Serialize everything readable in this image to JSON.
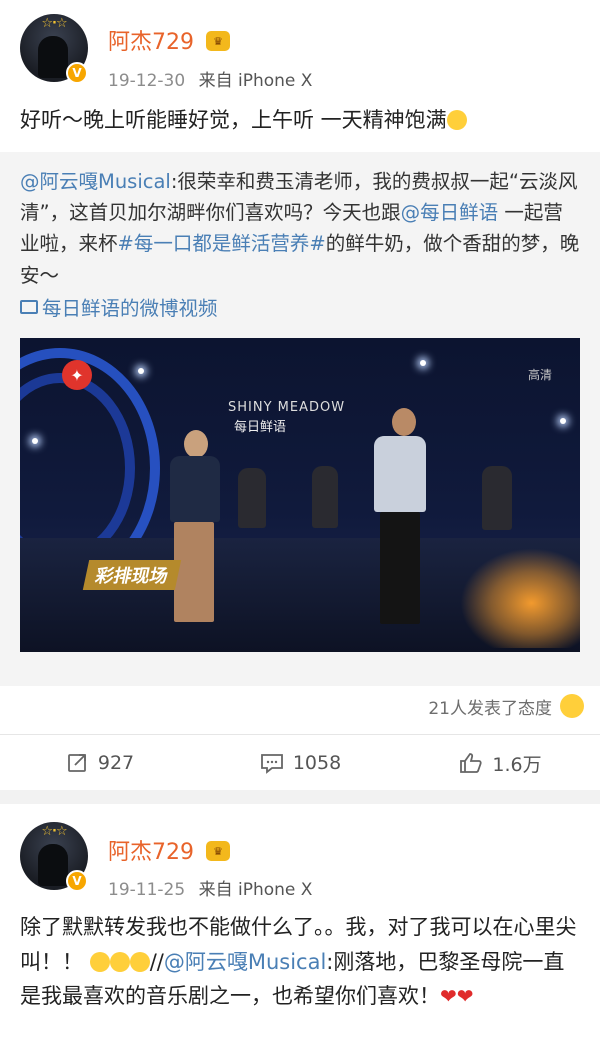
{
  "posts": [
    {
      "username": "阿杰729",
      "level_badge": "♛",
      "time": "19-12-30",
      "source_prefix": "来自",
      "source": "iPhone X",
      "text": "好听～晚上听能睡好觉，上午听 一天精神饱满",
      "repost": {
        "mention1": "@阿云嘎Musical",
        "text1": ":很荣幸和费玉清老师，我的费叔叔一起“云淡风清”，这首贝加尔湖畔你们喜欢吗？今天也跟",
        "mention2": "@每日鲜语",
        "text2": " 一起营业啦，来杯",
        "hashtag": "#每一口都是鲜活营养#",
        "text3": "的鲜牛奶，做个香甜的梦，晚安～",
        "video_link": "每日鲜语的微博视频",
        "video": {
          "brand_en": "SHINY MEADOW",
          "brand_cn": "每日鲜语",
          "quality": "高清",
          "banner": "彩排现场"
        }
      },
      "reactions_text": "21人发表了态度",
      "actions": {
        "repost": "927",
        "comment": "1058",
        "like": "1.6万"
      }
    },
    {
      "username": "阿杰729",
      "level_badge": "♛",
      "time": "19-11-25",
      "source_prefix": "来自",
      "source": "iPhone X",
      "text1": "除了默默转发我也不能做什么了。。我，对了我可以在心里尖叫！！",
      "sep": "//",
      "mention": "@阿云嘎Musical",
      "text2": ":刚落地，巴黎圣母院一直是我最喜欢的音乐剧之一，也希望你们喜欢！",
      "hearts": "❤❤"
    }
  ],
  "colors": {
    "username": "#e8632a",
    "link": "#4a7fb5",
    "vip": "#f7a600"
  }
}
